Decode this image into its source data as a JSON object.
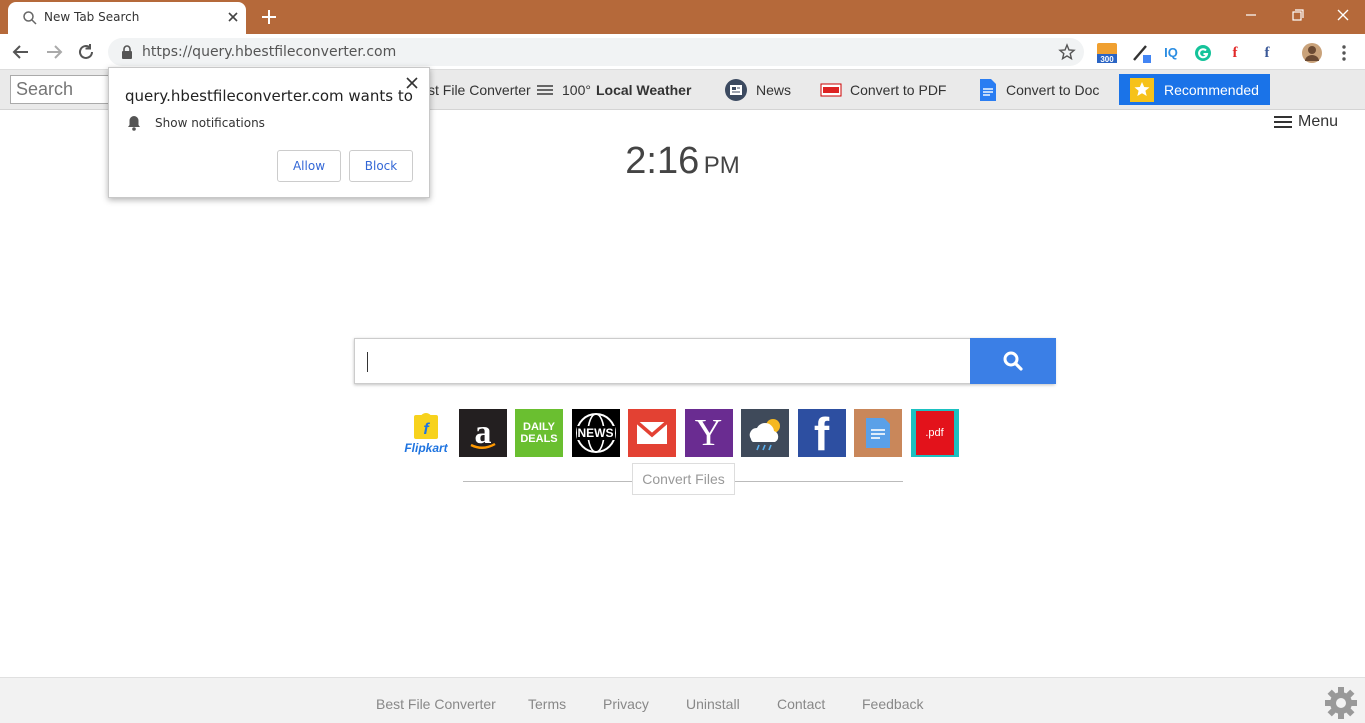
{
  "browser": {
    "tab_title": "New Tab Search",
    "url": "https://query.hbestfileconverter.com"
  },
  "extension_bar": {
    "search_placeholder": "Search",
    "items": [
      {
        "label": "st File Converter"
      },
      {
        "label_prefix": "100°",
        "label_bold": "Local Weather"
      },
      {
        "label": "News"
      },
      {
        "label": "Convert to PDF"
      },
      {
        "label": "Convert to Doc"
      }
    ],
    "recommended_label": "Recommended",
    "extensions": [
      "rss-300-icon",
      "pen-icon",
      "iq-icon",
      "grammarly-icon",
      "flipboard-icon",
      "facebook-icon",
      "avatar-icon",
      "more-icon"
    ],
    "ext_badge": "300",
    "ext_iq": "IQ"
  },
  "main": {
    "menu_label": "Menu",
    "time": "2:16",
    "ampm": "PM",
    "tiles": [
      {
        "name": "flipkart",
        "label": "Flipkart",
        "bg": "#ffffff"
      },
      {
        "name": "amazon",
        "bg": "#231f20"
      },
      {
        "name": "daily-deals",
        "label": "DAILY DEALS",
        "bg": "#6abf30"
      },
      {
        "name": "news",
        "label": "NEWS",
        "bg": "#000000"
      },
      {
        "name": "gmail",
        "bg": "#e34133"
      },
      {
        "name": "yahoo",
        "label": "Y",
        "bg": "#6a2c91"
      },
      {
        "name": "weather",
        "bg": "#3f4a5a"
      },
      {
        "name": "facebook",
        "label": "f",
        "bg": "#2d4fa1"
      },
      {
        "name": "docs",
        "bg": "#c9875a"
      },
      {
        "name": "pdf",
        "label": ".pdf",
        "bg": "#1cc1c1"
      }
    ],
    "convert_files": "Convert Files"
  },
  "footer": {
    "links": [
      "Best File Converter",
      "Terms",
      "Privacy",
      "Uninstall",
      "Contact",
      "Feedback"
    ]
  },
  "popup": {
    "title": "query.hbestfileconverter.com wants to",
    "permission": "Show notifications",
    "allow": "Allow",
    "block": "Block"
  },
  "colors": {
    "titlebar": "#b5693a",
    "search_button": "#3b7fe6",
    "recommended": "#1a73e8"
  }
}
